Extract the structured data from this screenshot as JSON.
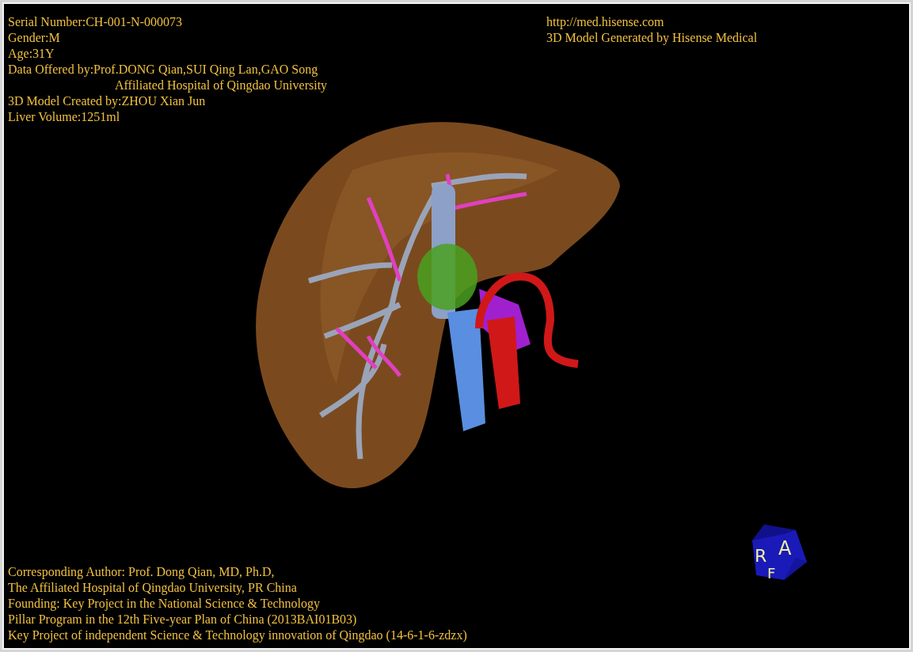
{
  "patient_info": [
    {
      "text": "Serial Number:CH-001-N-000073",
      "kind": "line"
    },
    {
      "text": "Gender:M",
      "kind": "line"
    },
    {
      "text": "Age:31Y",
      "kind": "line"
    },
    {
      "text": "Data Offered by:Prof.DONG Qian,SUI Qing Lan,GAO Song",
      "kind": "line"
    },
    {
      "text": "Affiliated Hospital of Qingdao University",
      "kind": "continuation"
    },
    {
      "text": "3D Model Created by:ZHOU Xian Jun",
      "kind": "line"
    },
    {
      "text": "Liver Volume:1251ml",
      "kind": "line"
    }
  ],
  "source_info": [
    "http://med.hisense.com",
    "3D Model Generated by Hisense Medical"
  ],
  "credits": [
    "Corresponding Author: Prof. Dong Qian, MD, Ph.D,",
    "The Affiliated Hospital of Qingdao University, PR China",
    "Founding: Key Project in the National Science & Technology",
    "Pillar Program in the 12th Five-year Plan of China (2013BAI01B03)",
    "Key Project of independent Science & Technology innovation of Qingdao (14-6-1-6-zdzx)"
  ],
  "orientation_cube": {
    "labels": [
      "R",
      "A",
      "F"
    ]
  }
}
